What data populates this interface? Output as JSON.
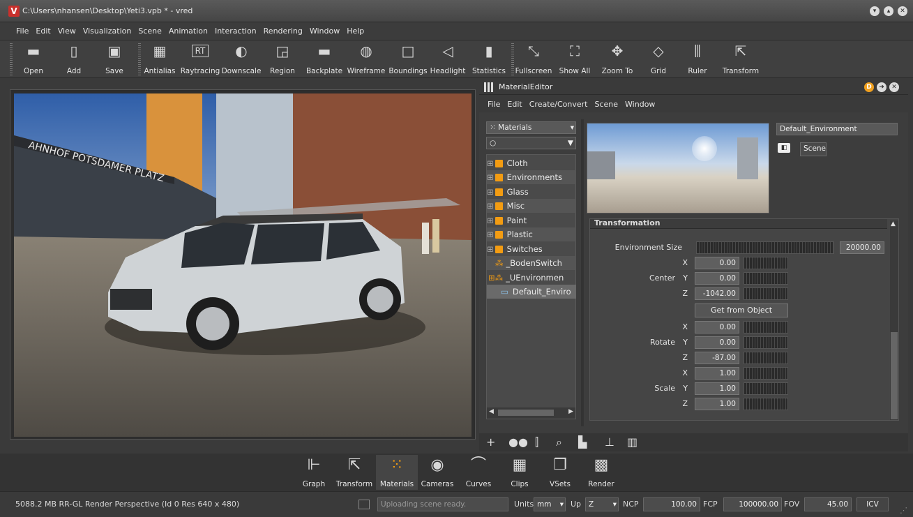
{
  "window": {
    "title": "C:\\Users\\nhansen\\Desktop\\Yeti3.vpb * - vred",
    "app_icon": "V"
  },
  "menubar": [
    "File",
    "Edit",
    "View",
    "Visualization",
    "Scene",
    "Animation",
    "Interaction",
    "Rendering",
    "Window",
    "Help"
  ],
  "toolbar": {
    "open": "Open",
    "add": "Add",
    "save": "Save",
    "antialias": "Antialias",
    "raytracing": "Raytracing",
    "downscale": "Downscale",
    "region": "Region",
    "backplate": "Backplate",
    "wireframe": "Wireframe",
    "boundings": "Boundings",
    "headlight": "Headlight",
    "statistics": "Statistics",
    "fullscreen": "Fullscreen",
    "showall": "Show All",
    "zoomto": "Zoom To",
    "grid": "Grid",
    "ruler": "Ruler",
    "transform": "Transform"
  },
  "material_editor": {
    "title": "MaterialEditor",
    "menu": [
      "File",
      "Edit",
      "Create/Convert",
      "Scene",
      "Window"
    ],
    "dropdown": "Materials",
    "tree": [
      {
        "label": "Cloth",
        "kind": "folder"
      },
      {
        "label": "Environments",
        "kind": "folder"
      },
      {
        "label": "Glass",
        "kind": "folder"
      },
      {
        "label": "Misc",
        "kind": "folder"
      },
      {
        "label": "Paint",
        "kind": "folder"
      },
      {
        "label": "Plastic",
        "kind": "folder"
      },
      {
        "label": "Switches",
        "kind": "folder"
      },
      {
        "label": "_BodenSwitch",
        "kind": "switch"
      },
      {
        "label": "_UEnvironmen",
        "kind": "switch"
      },
      {
        "label": "Default_Enviro",
        "kind": "env"
      }
    ],
    "material_name": "Default_Environment",
    "scene_button": "Scene",
    "section_title": "Transformation",
    "env_size_label": "Environment Size",
    "env_size_value": "20000.00",
    "center_label": "Center",
    "rotate_label": "Rotate",
    "scale_label": "Scale",
    "x": "X",
    "y": "Y",
    "z": "Z",
    "center": {
      "x": "0.00",
      "y": "0.00",
      "z": "-1042.00"
    },
    "get_from_object": "Get from Object",
    "rotate": {
      "x": "0.00",
      "y": "0.00",
      "z": "-87.00"
    },
    "scale": {
      "x": "1.00",
      "y": "1.00",
      "z": "1.00"
    }
  },
  "bottom_tools": [
    "Graph",
    "Transform",
    "Materials",
    "Cameras",
    "Curves",
    "Clips",
    "VSets",
    "Render"
  ],
  "status": {
    "memory": "5088.2 MB  RR-GL  Render Perspective (Id 0 Res 640 x 480)",
    "message": "Uploading scene ready.",
    "units_label": "Units",
    "units_value": "mm",
    "up_label": "Up",
    "up_value": "Z",
    "ncp_label": "NCP",
    "ncp_value": "100.00",
    "fcp_label": "FCP",
    "fcp_value": "100000.00",
    "fov_label": "FOV",
    "fov_value": "45.00",
    "icv": "ICV"
  },
  "viewport": {
    "sign_text": "AHNHOF POTSDAMER PLATZ"
  }
}
